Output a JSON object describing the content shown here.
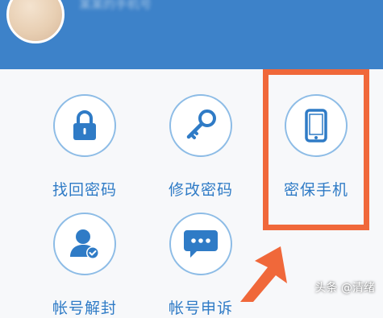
{
  "header": {
    "user_name": "某某的手机号"
  },
  "menu": [
    {
      "label": "找回密码",
      "icon": "lock-icon"
    },
    {
      "label": "修改密码",
      "icon": "key-icon"
    },
    {
      "label": "密保手机",
      "icon": "phone-icon"
    },
    {
      "label": "帐号解封",
      "icon": "user-check-icon"
    },
    {
      "label": "帐号申诉",
      "icon": "chat-bubble-icon"
    }
  ],
  "watermark": "头条 @清绪",
  "colors": {
    "header": "#3d82c9",
    "accent": "#2f7bc6",
    "highlight": "#f0683a"
  }
}
